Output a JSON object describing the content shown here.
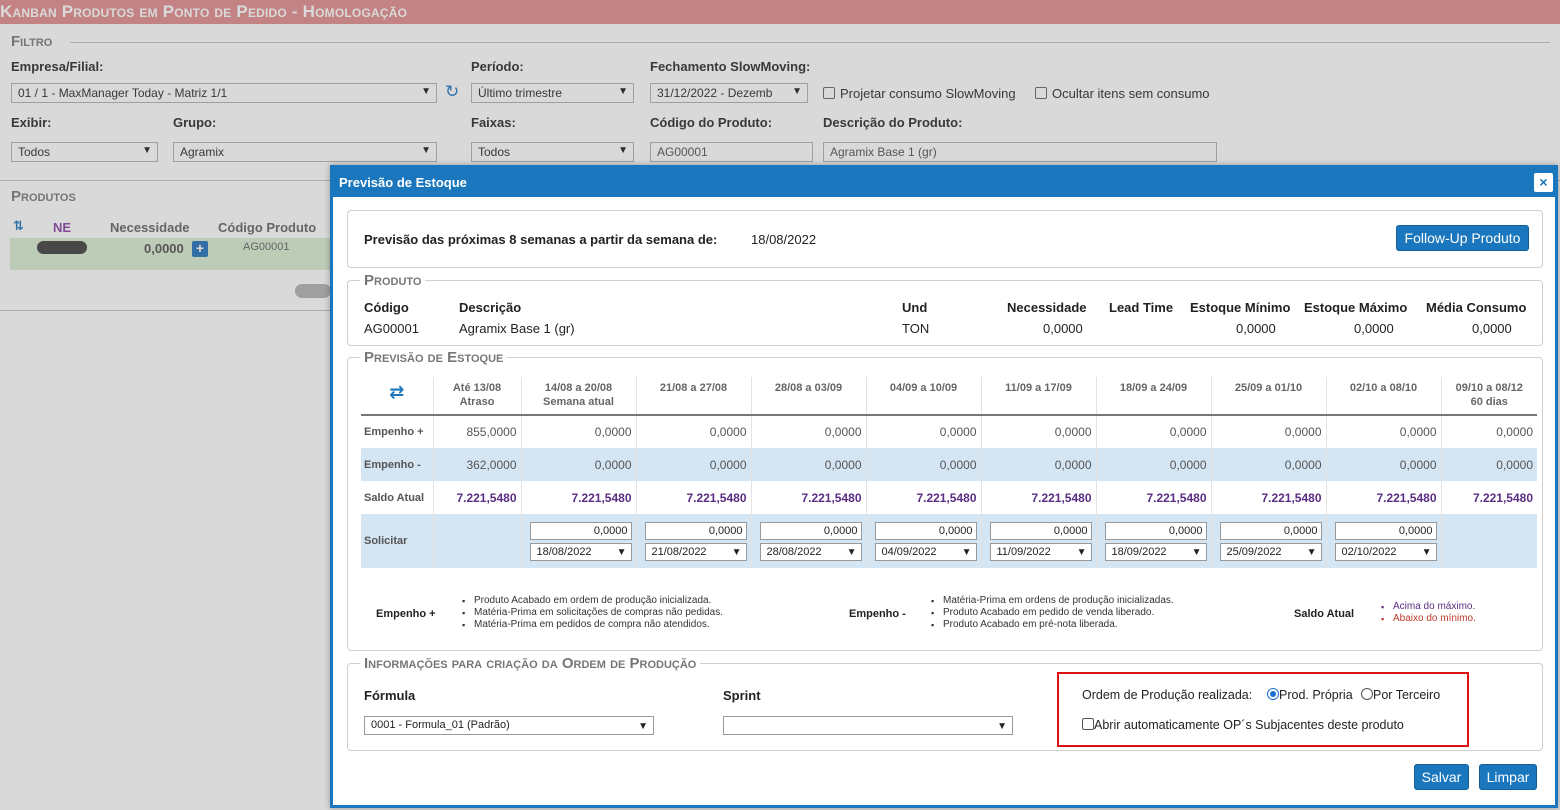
{
  "app": {
    "title": "Kanban Produtos em Ponto de Pedido - Homologação"
  },
  "filtro": {
    "section": "Filtro",
    "empresa_label": "Empresa/Filial:",
    "empresa_value": "01 / 1 - MaxManager Today - Matriz 1/1",
    "periodo_label": "Período:",
    "periodo_value": "Último trimestre",
    "fechamento_label": "Fechamento SlowMoving:",
    "fechamento_value": "31/12/2022 - Dezemb",
    "projetar_label": "Projetar consumo SlowMoving",
    "ocultar_label": "Ocultar itens sem consumo",
    "exibir_label": "Exibir:",
    "exibir_value": "Todos",
    "grupo_label": "Grupo:",
    "grupo_value": "Agramix",
    "faixas_label": "Faixas:",
    "faixas_value": "Todos",
    "codigo_label": "Código do Produto:",
    "codigo_value": "AG00001",
    "descricao_label": "Descrição do Produto:",
    "descricao_value": "Agramix Base 1 (gr)"
  },
  "produtos": {
    "section": "Produtos",
    "col_ne": "NE",
    "col_necessidade": "Necessidade",
    "col_codigo": "Código Produto",
    "row_necessidade": "0,0000",
    "row_codigo": "AG00001"
  },
  "dialog": {
    "title": "Previsão de Estoque",
    "close": "×",
    "intro_label": "Previsão das próximas 8 semanas a partir da semana de:",
    "intro_date": "18/08/2022",
    "followup_button": "Follow-Up Produto",
    "produto": {
      "legend": "Produto",
      "h_codigo": "Código",
      "h_descricao": "Descrição",
      "h_und": "Und",
      "h_necessidade": "Necessidade",
      "h_lead": "Lead Time",
      "h_emin": "Estoque Mínimo",
      "h_emax": "Estoque Máximo",
      "h_media": "Média Consumo",
      "v_codigo": "AG00001",
      "v_descricao": "Agramix Base 1 (gr)",
      "v_und": "TON",
      "v_necessidade": "0,0000",
      "v_lead": "",
      "v_emin": "0,0000",
      "v_emax": "0,0000",
      "v_media": "0,0000"
    },
    "previsao": {
      "legend": "Previsão de Estoque",
      "columns": [
        {
          "l1": "Até 13/08",
          "l2": "Atraso"
        },
        {
          "l1": "14/08 a 20/08",
          "l2": "Semana atual"
        },
        {
          "l1": "21/08 a 27/08",
          "l2": ""
        },
        {
          "l1": "28/08 a 03/09",
          "l2": ""
        },
        {
          "l1": "04/09 a 10/09",
          "l2": ""
        },
        {
          "l1": "11/09 a 17/09",
          "l2": ""
        },
        {
          "l1": "18/09 a 24/09",
          "l2": ""
        },
        {
          "l1": "25/09 a 01/10",
          "l2": ""
        },
        {
          "l1": "02/10 a 08/10",
          "l2": ""
        },
        {
          "l1": "09/10 a 08/12",
          "l2": "60 dias"
        }
      ],
      "rows": {
        "empenho_mais": {
          "label": "Empenho +",
          "values": [
            "855,0000",
            "0,0000",
            "0,0000",
            "0,0000",
            "0,0000",
            "0,0000",
            "0,0000",
            "0,0000",
            "0,0000",
            "0,0000"
          ]
        },
        "empenho_menos": {
          "label": "Empenho -",
          "values": [
            "362,0000",
            "0,0000",
            "0,0000",
            "0,0000",
            "0,0000",
            "0,0000",
            "0,0000",
            "0,0000",
            "0,0000",
            "0,0000"
          ]
        },
        "saldo_atual": {
          "label": "Saldo Atual",
          "values": [
            "7.221,5480",
            "7.221,5480",
            "7.221,5480",
            "7.221,5480",
            "7.221,5480",
            "7.221,5480",
            "7.221,5480",
            "7.221,5480",
            "7.221,5480",
            "7.221,5480"
          ]
        },
        "solicitar": {
          "label": "Solicitar",
          "qty": [
            "0,0000",
            "0,0000",
            "0,0000",
            "0,0000",
            "0,0000",
            "0,0000",
            "0,0000",
            "0,0000"
          ],
          "dates": [
            "18/08/2022",
            "21/08/2022",
            "28/08/2022",
            "04/09/2022",
            "11/09/2022",
            "18/09/2022",
            "25/09/2022",
            "02/10/2022"
          ]
        }
      },
      "legend_empenho_mais": {
        "label": "Empenho +",
        "items": [
          "Produto Acabado em ordem de produção inicializada.",
          "Matéria-Prima em solicitações de compras não pedidas.",
          "Matéria-Prima em pedidos de compra não atendidos."
        ]
      },
      "legend_empenho_menos": {
        "label": "Empenho -",
        "items": [
          "Matéria-Prima em ordens de produção inicializadas.",
          "Produto Acabado em pedido de venda liberado.",
          "Produto Acabado em pré-nota liberada."
        ]
      },
      "legend_saldo": {
        "label": "Saldo Atual",
        "items": [
          "Acima do máximo.",
          "Abaixo do mínimo."
        ]
      }
    },
    "ordem": {
      "legend": "Informações para criação da Ordem de Produção",
      "formula_label": "Fórmula",
      "formula_value": "0001 - Formula_01 (Padrão)",
      "sprint_label": "Sprint",
      "sprint_value": "",
      "op_label": "Ordem de Produção realizada:",
      "opt_propria": "Prod. Própria",
      "opt_terceiro": "Por Terceiro",
      "abrir_label": "Abrir automaticamente OP´s Subjacentes deste produto"
    },
    "salvar_button": "Salvar",
    "limpar_button": "Limpar"
  },
  "colors": {
    "title_bar": "#e59a9c",
    "dialog_blue": "#1a77bd",
    "row_blue": "#d4e5f4",
    "saldo_purple": "#5a2d82",
    "highlight_red": "#dd1111"
  }
}
